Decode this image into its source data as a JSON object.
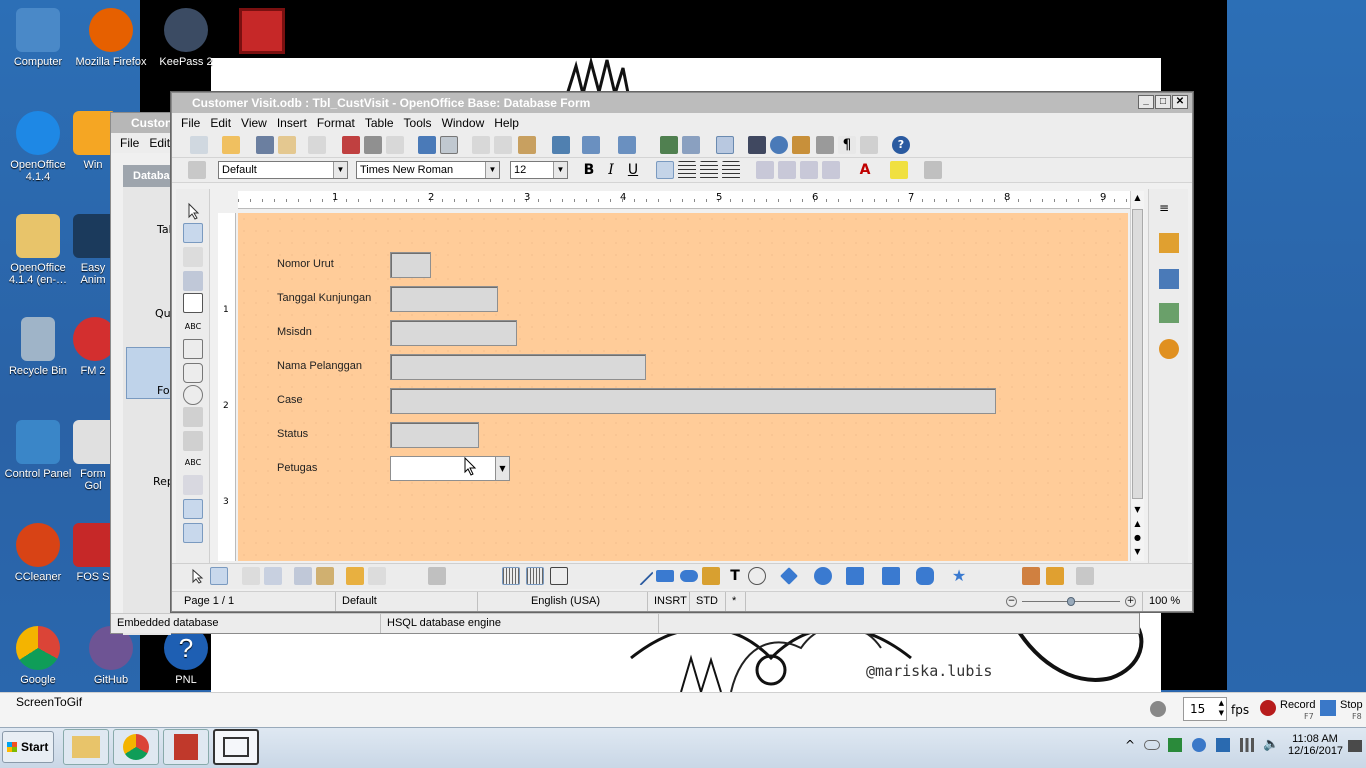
{
  "desktop": {
    "icons": [
      {
        "label": "Computer",
        "color": "#4a89c8"
      },
      {
        "label": "Mozilla Firefox",
        "color": "#e66000"
      },
      {
        "label": "KeePass 2",
        "color": "#3b4b63"
      },
      {
        "label": "",
        "color": "#c62828"
      },
      {
        "label": "OpenOffice 4.1.4",
        "color": "#1e88e5"
      },
      {
        "label": "Win",
        "color": "#f5a623"
      },
      {
        "label": "OpenOffice 4.1.4 (en-…",
        "color": "#e8c46a"
      },
      {
        "label": "Easy Anim",
        "color": "#1b3a5c"
      },
      {
        "label": "Recycle Bin",
        "color": "#9fb4c8"
      },
      {
        "label": "FM 2",
        "color": "#d32f2f"
      },
      {
        "label": "Control Panel",
        "color": "#3a86c8"
      },
      {
        "label": "Form Gol",
        "color": "#e0e0e0"
      },
      {
        "label": "CCleaner",
        "color": "#d84315"
      },
      {
        "label": "FOS S",
        "color": "#c62828"
      },
      {
        "label": "Google",
        "color": "#4285f4"
      },
      {
        "label": "GitHub",
        "color": "#6e5494"
      },
      {
        "label": "PNL",
        "color": "#1e5fb3"
      }
    ]
  },
  "wallpaper": {
    "signature": "@mariska.lubis"
  },
  "back_window": {
    "title": "Custon",
    "menu": [
      "File",
      "Edit"
    ],
    "panel_title": "Databa",
    "items": [
      "Tab",
      "Que",
      "Fo",
      "Rep"
    ],
    "status": [
      "Embedded database",
      "HSQL database engine"
    ]
  },
  "main_window": {
    "title": "Customer Visit.odb : Tbl_CustVisit - OpenOffice Base: Database Form",
    "menu": [
      "File",
      "Edit",
      "View",
      "Insert",
      "Format",
      "Table",
      "Tools",
      "Window",
      "Help"
    ],
    "paragraph_style": "Default",
    "font_name": "Times New Roman",
    "font_size": "12",
    "ruler_numbers": [
      "1",
      "2",
      "3",
      "4",
      "5",
      "6",
      "7",
      "8",
      "9"
    ],
    "vruler_numbers": [
      "1",
      "2",
      "3"
    ],
    "form": {
      "background": "#ffcc99",
      "fields": [
        {
          "label": "Nomor Urut",
          "value": ""
        },
        {
          "label": "Tanggal Kunjungan",
          "value": ""
        },
        {
          "label": "Msisdn",
          "value": ""
        },
        {
          "label": "Nama Pelanggan",
          "value": ""
        },
        {
          "label": "Case",
          "value": ""
        },
        {
          "label": "Status",
          "value": ""
        },
        {
          "label": "Petugas",
          "value": ""
        }
      ]
    },
    "status": {
      "page": "Page 1 / 1",
      "style": "Default",
      "language": "English (USA)",
      "insert": "INSRT",
      "selection": "STD",
      "modified": "*",
      "zoom": "100 %",
      "zoom_level": 0.5
    }
  },
  "screentogif": {
    "title": "ScreenToGif",
    "fps_value": "15",
    "fps_label": "fps",
    "record_label": "Record",
    "record_key": "F7",
    "stop_label": "Stop",
    "stop_key": "F8"
  },
  "taskbar": {
    "start_label": "Start",
    "time": "11:08 AM",
    "date": "12/16/2017"
  }
}
